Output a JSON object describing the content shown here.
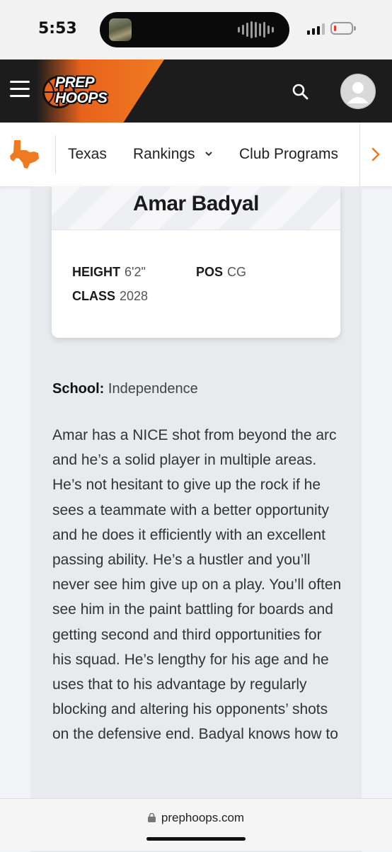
{
  "status_bar": {
    "time": "5:53",
    "battery_level": 0.12
  },
  "header": {
    "brand": "PREP HOOPS",
    "brand_line1": "PREP",
    "brand_line2": "HOOPS",
    "accent_color": "#f07a21"
  },
  "nav": {
    "items": [
      {
        "label": "Texas"
      },
      {
        "label": "Rankings"
      },
      {
        "label": "Club Programs"
      }
    ]
  },
  "player": {
    "name": "Amar Badyal",
    "height_label": "HEIGHT",
    "height_value": "6'2\"",
    "pos_label": "POS",
    "pos_value": "CG",
    "class_label": "CLASS",
    "class_value": "2028"
  },
  "article": {
    "school_label": "School:",
    "school_value": "Independence",
    "body": "Amar has a NICE shot from beyond the arc and he’s a solid player in multiple areas. He’s not hesitant to give up the rock if he sees a teammate with a better opportunity and he does it efficiently with an excellent passing ability. He’s a hustler and you’ll never see him give up on a play. You’ll often see him in the paint battling for boards and getting second and third opportunities for his squad. He’s lengthy for his age and he uses that to his advantage by regularly blocking and altering his opponents’ shots on the defensive end. Badyal knows how to"
  },
  "browser": {
    "url": "prephoops.com"
  }
}
